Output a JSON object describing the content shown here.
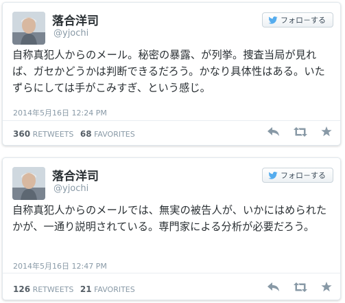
{
  "tweets": [
    {
      "name": "落合洋司",
      "handle": "@yjochi",
      "follow_label": "フォロ－する",
      "text": "自称真犯人からのメール。秘密の暴露、が列挙。捜査当局が見れば、ガセかどうかは判断できるだろう。かなり具体性はある。いたずらにしては手がこみすぎ、という感じ。",
      "date": "2014年5月16日 12:24 PM",
      "retweets_count": "360",
      "retweets_label": "RETWEETS",
      "favorites_count": "68",
      "favorites_label": "FAVORITES"
    },
    {
      "name": "落合洋司",
      "handle": "@yjochi",
      "follow_label": "フォロ－する",
      "text": "自称真犯人からのメールでは、無実の被告人が、いかにはめられたかが、一通り説明されている。専門家による分析が必要だろう。",
      "date": "2014年5月16日 12:47 PM",
      "retweets_count": "126",
      "retweets_label": "RETWEETS",
      "favorites_count": "21",
      "favorites_label": "FAVORITES"
    }
  ],
  "icons": {
    "follow": "twitter-bird-icon",
    "reply": "reply-arrow-icon",
    "retweet": "retweet-icon",
    "favorite": "star-icon"
  },
  "colors": {
    "name": "#292f33",
    "meta": "#8899a6",
    "icon": "#8899a6",
    "bird": "#55acee"
  }
}
